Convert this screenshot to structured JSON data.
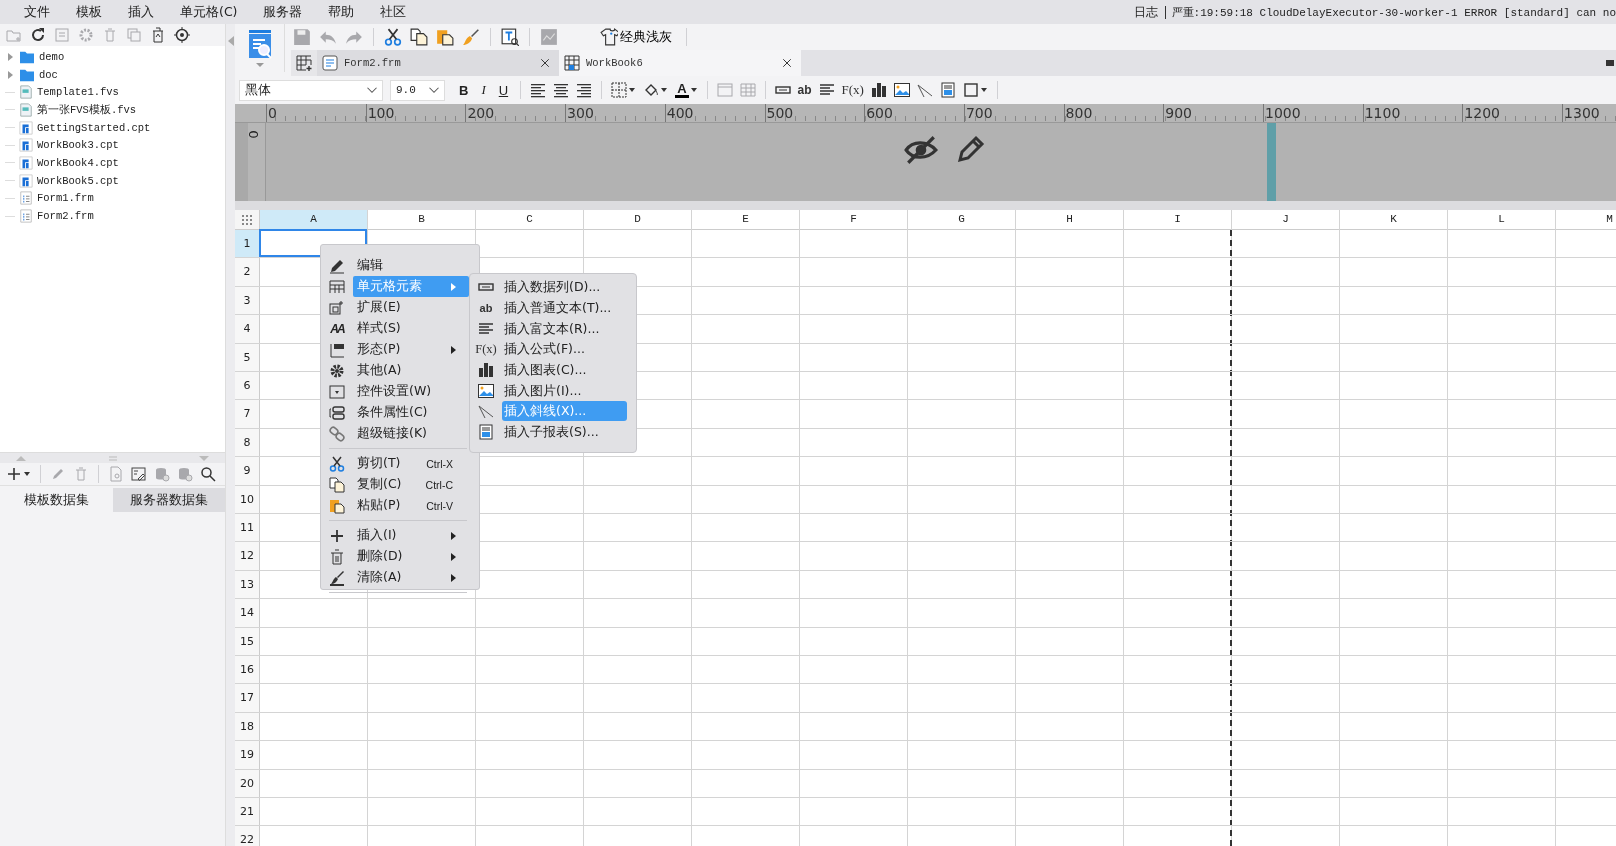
{
  "menubar": {
    "items": [
      "文件",
      "模板",
      "插入",
      "单元格(C)",
      "服务器",
      "帮助",
      "社区"
    ],
    "log_label": "日志",
    "log_message": "严重:19:59:18 CloudDelayExecutor-30-worker-1 ERROR [standard] can no"
  },
  "file_tree": {
    "items": [
      {
        "kind": "folder",
        "name": "demo",
        "expanded": false
      },
      {
        "kind": "folder",
        "name": "doc",
        "expanded": false
      },
      {
        "kind": "fvs",
        "name": "Template1.fvs"
      },
      {
        "kind": "fvs",
        "name": "第一张FVS模板.fvs"
      },
      {
        "kind": "cpt",
        "name": "GettingStarted.cpt"
      },
      {
        "kind": "cpt",
        "name": "WorkBook3.cpt"
      },
      {
        "kind": "cpt",
        "name": "WorkBook4.cpt"
      },
      {
        "kind": "cpt",
        "name": "WorkBook5.cpt"
      },
      {
        "kind": "frm",
        "name": "Form1.frm"
      },
      {
        "kind": "frm",
        "name": "Form2.frm"
      }
    ]
  },
  "dataset_panel": {
    "tabs": [
      {
        "label": "模板数据集",
        "selected": true
      },
      {
        "label": "服务器数据集",
        "selected": false
      }
    ]
  },
  "toolbar": {
    "theme_button": "经典浅灰"
  },
  "document_tabs": [
    {
      "label": "Form2.frm",
      "kind": "form",
      "selected": false
    },
    {
      "label": "WorkBook6",
      "kind": "workbook",
      "selected": true
    }
  ],
  "format_toolbar": {
    "font": "黑体",
    "size": "9.0",
    "style_buttons": [
      "B",
      "I",
      "U"
    ],
    "font_color_glyph": "A",
    "insert_glyphs": [
      "ab",
      "F(x)"
    ]
  },
  "ruler": {
    "marks": [
      "0",
      "100",
      "200",
      "300",
      "400",
      "500",
      "600",
      "700",
      "800",
      "900",
      "1000",
      "1100",
      "1200",
      "1300"
    ],
    "vertical_mark": "0"
  },
  "sheet": {
    "columns": [
      {
        "label": "A",
        "selected": true,
        "page_break": false
      },
      {
        "label": "B",
        "selected": false,
        "page_break": false
      },
      {
        "label": "C",
        "selected": false,
        "page_break": false
      },
      {
        "label": "D",
        "selected": false,
        "page_break": false
      },
      {
        "label": "E",
        "selected": false,
        "page_break": false
      },
      {
        "label": "F",
        "selected": false,
        "page_break": false
      },
      {
        "label": "G",
        "selected": false,
        "page_break": false
      },
      {
        "label": "H",
        "selected": false,
        "page_break": false
      },
      {
        "label": "I",
        "selected": false,
        "page_break": true
      },
      {
        "label": "J",
        "selected": false,
        "page_break": false
      },
      {
        "label": "K",
        "selected": false,
        "page_break": false
      },
      {
        "label": "L",
        "selected": false,
        "page_break": false
      },
      {
        "label": "M",
        "selected": false,
        "page_break": false
      }
    ],
    "rows": [
      {
        "label": "1",
        "selected": true
      },
      {
        "label": "2",
        "selected": false
      },
      {
        "label": "3",
        "selected": false
      },
      {
        "label": "4",
        "selected": false
      },
      {
        "label": "5",
        "selected": false
      },
      {
        "label": "6",
        "selected": false
      },
      {
        "label": "7",
        "selected": false
      },
      {
        "label": "8",
        "selected": false
      },
      {
        "label": "9",
        "selected": false
      },
      {
        "label": "10",
        "selected": false
      },
      {
        "label": "11",
        "selected": false
      },
      {
        "label": "12",
        "selected": false
      },
      {
        "label": "13",
        "selected": false
      },
      {
        "label": "14",
        "selected": false
      },
      {
        "label": "15",
        "selected": false
      },
      {
        "label": "16",
        "selected": false
      },
      {
        "label": "17",
        "selected": false
      },
      {
        "label": "18",
        "selected": false
      },
      {
        "label": "19",
        "selected": false
      },
      {
        "label": "20",
        "selected": false
      },
      {
        "label": "21",
        "selected": false
      },
      {
        "label": "22",
        "selected": false
      }
    ]
  },
  "context_menu": {
    "items": [
      {
        "kind": "item",
        "label": "编辑",
        "selected": false,
        "has_submenu": false
      },
      {
        "kind": "item",
        "label": "单元格元素",
        "selected": true,
        "has_submenu": true
      },
      {
        "kind": "item",
        "label": "扩展(E)",
        "selected": false,
        "has_submenu": false
      },
      {
        "kind": "item",
        "label": "样式(S)",
        "selected": false,
        "has_submenu": false,
        "glyph": "AA"
      },
      {
        "kind": "item",
        "label": "形态(P)",
        "selected": false,
        "has_submenu": true
      },
      {
        "kind": "item",
        "label": "其他(A)",
        "selected": false,
        "has_submenu": false
      },
      {
        "kind": "item",
        "label": "控件设置(W)",
        "selected": false,
        "has_submenu": false
      },
      {
        "kind": "item",
        "label": "条件属性(C)",
        "selected": false,
        "has_submenu": false
      },
      {
        "kind": "item",
        "label": "超级链接(K)",
        "selected": false,
        "has_submenu": false
      },
      {
        "kind": "separator"
      },
      {
        "kind": "item",
        "label": "剪切(T)",
        "shortcut": "Ctrl-X",
        "selected": false,
        "has_submenu": false
      },
      {
        "kind": "item",
        "label": "复制(C)",
        "shortcut": "Ctrl-C",
        "selected": false,
        "has_submenu": false
      },
      {
        "kind": "item",
        "label": "粘贴(P)",
        "shortcut": "Ctrl-V",
        "selected": false,
        "has_submenu": false
      },
      {
        "kind": "separator"
      },
      {
        "kind": "item",
        "label": "插入(I)",
        "selected": false,
        "has_submenu": true
      },
      {
        "kind": "item",
        "label": "删除(D)",
        "selected": false,
        "has_submenu": true
      },
      {
        "kind": "item",
        "label": "清除(A)",
        "selected": false,
        "has_submenu": true
      },
      {
        "kind": "separator"
      }
    ]
  },
  "submenu": {
    "items": [
      {
        "label": "插入数据列(D)...",
        "selected": false
      },
      {
        "label": "插入普通文本(T)...",
        "selected": false,
        "glyph": "ab"
      },
      {
        "label": "插入富文本(R)...",
        "selected": false
      },
      {
        "label": "插入公式(F)...",
        "selected": false,
        "glyph": "F(x)"
      },
      {
        "label": "插入图表(C)...",
        "selected": false
      },
      {
        "label": "插入图片(I)...",
        "selected": false
      },
      {
        "label": "插入斜线(X)...",
        "selected": true
      },
      {
        "label": "插入子报表(S)...",
        "selected": false
      }
    ]
  }
}
